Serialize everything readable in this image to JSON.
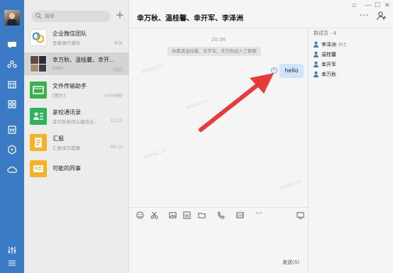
{
  "search": {
    "placeholder": "搜索"
  },
  "conversations": [
    {
      "title": "企业微信团队",
      "sub": "登录操作通知",
      "time": "昨天"
    },
    {
      "title": "幸万秋、温桂馨、幸开...",
      "sub": "hello",
      "time": ""
    },
    {
      "title": "文件传输助手",
      "sub": "[图片]",
      "time": "47分钟前"
    },
    {
      "title": "家校通讯录",
      "sub": "幸万秋老师从微信迁...",
      "time": "11:55"
    },
    {
      "title": "汇报",
      "sub": "汇报填写提醒",
      "time": "09:13"
    },
    {
      "title": "可能的同事",
      "sub": "",
      "time": ""
    }
  ],
  "chat": {
    "title": "幸万秋、温桂馨、幸开军、李泽洲",
    "timestamp": "20:36",
    "system_msg": "你邀请温桂馨、幸开军、幸万秋加入了群聊",
    "message": "hello",
    "unread_marker": "1",
    "send_label": "发送(S)"
  },
  "members": {
    "title": "群成员 · 4",
    "list": [
      {
        "name": "李泽洲",
        "role": "群主"
      },
      {
        "name": "温桂馨",
        "role": ""
      },
      {
        "name": "幸开军",
        "role": ""
      },
      {
        "name": "幸万秋",
        "role": ""
      }
    ]
  },
  "window": {
    "more": "···"
  },
  "colors": {
    "rail": "#3b7bc6",
    "bubble": "#cfe5fb",
    "arrow": "#e83a3a"
  },
  "watermark": "李泽洲2576"
}
